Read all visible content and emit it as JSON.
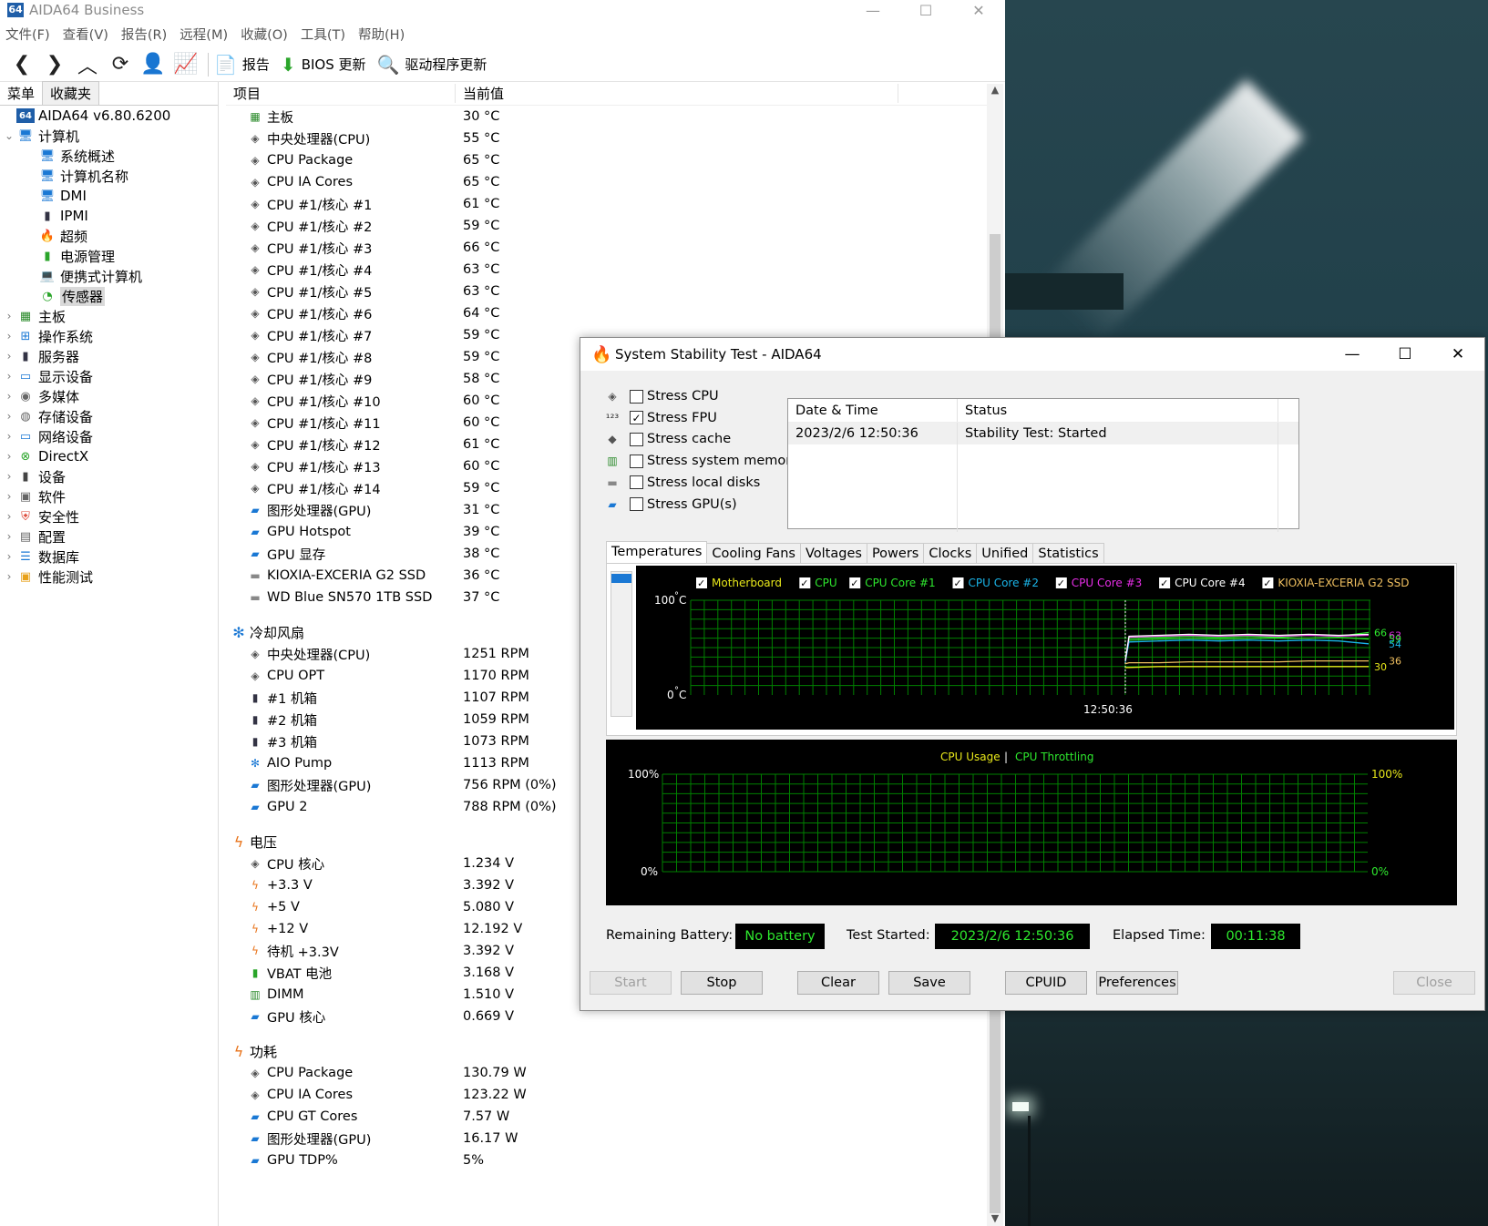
{
  "main_window": {
    "icon_text": "64",
    "title": "AIDA64 Business",
    "menu": [
      "文件(F)",
      "查看(V)",
      "报告(R)",
      "远程(M)",
      "收藏(O)",
      "工具(T)",
      "帮助(H)"
    ],
    "toolbar": {
      "report": "报告",
      "bios_update": "BIOS 更新",
      "driver_update": "驱动程序更新"
    },
    "left_tabs": [
      "菜单",
      "收藏夹"
    ],
    "tree": [
      {
        "label": "AIDA64 v6.80.6200",
        "icon": "aida-icon",
        "indent": 0,
        "arrow": ""
      },
      {
        "label": "计算机",
        "icon": "computer-icon",
        "indent": 0,
        "arrow": "down"
      },
      {
        "label": "系统概述",
        "icon": "computer-icon",
        "indent": 2,
        "arrow": ""
      },
      {
        "label": "计算机名称",
        "icon": "computer-icon",
        "indent": 2,
        "arrow": ""
      },
      {
        "label": "DMI",
        "icon": "computer-icon",
        "indent": 2,
        "arrow": ""
      },
      {
        "label": "IPMI",
        "icon": "server-icon",
        "indent": 2,
        "arrow": ""
      },
      {
        "label": "超频",
        "icon": "flame-icon",
        "indent": 2,
        "arrow": ""
      },
      {
        "label": "电源管理",
        "icon": "battery-icon",
        "indent": 2,
        "arrow": ""
      },
      {
        "label": "便携式计算机",
        "icon": "laptop-icon",
        "indent": 2,
        "arrow": ""
      },
      {
        "label": "传感器",
        "icon": "gauge-icon",
        "indent": 2,
        "arrow": "",
        "selected": true
      },
      {
        "label": "主板",
        "icon": "motherboard-icon",
        "indent": 0,
        "arrow": "right"
      },
      {
        "label": "操作系统",
        "icon": "windows-icon",
        "indent": 0,
        "arrow": "right"
      },
      {
        "label": "服务器",
        "icon": "server-icon",
        "indent": 0,
        "arrow": "right"
      },
      {
        "label": "显示设备",
        "icon": "monitor-icon",
        "indent": 0,
        "arrow": "right"
      },
      {
        "label": "多媒体",
        "icon": "speaker-icon",
        "indent": 0,
        "arrow": "right"
      },
      {
        "label": "存储设备",
        "icon": "storage-icon",
        "indent": 0,
        "arrow": "right"
      },
      {
        "label": "网络设备",
        "icon": "network-icon",
        "indent": 0,
        "arrow": "right"
      },
      {
        "label": "DirectX",
        "icon": "xbox-icon",
        "indent": 0,
        "arrow": "right"
      },
      {
        "label": "设备",
        "icon": "device-icon",
        "indent": 0,
        "arrow": "right"
      },
      {
        "label": "软件",
        "icon": "software-icon",
        "indent": 0,
        "arrow": "right"
      },
      {
        "label": "安全性",
        "icon": "shield-icon",
        "indent": 0,
        "arrow": "right"
      },
      {
        "label": "配置",
        "icon": "config-icon",
        "indent": 0,
        "arrow": "right"
      },
      {
        "label": "数据库",
        "icon": "database-icon",
        "indent": 0,
        "arrow": "right"
      },
      {
        "label": "性能测试",
        "icon": "benchmark-icon",
        "indent": 0,
        "arrow": "right"
      }
    ],
    "list_headers": {
      "item": "项目",
      "value": "当前值"
    },
    "groups": [
      {
        "title": "",
        "icon": "",
        "rows": [
          {
            "name": "主板",
            "value": "30 °C",
            "icon": "motherboard-icon"
          },
          {
            "name": "中央处理器(CPU)",
            "value": "55 °C",
            "icon": "cpu-icon"
          },
          {
            "name": "CPU Package",
            "value": "65 °C",
            "icon": "cpu-icon"
          },
          {
            "name": "CPU IA Cores",
            "value": "65 °C",
            "icon": "cpu-icon"
          },
          {
            "name": "CPU #1/核心 #1",
            "value": "61 °C",
            "icon": "cpu-icon"
          },
          {
            "name": "CPU #1/核心 #2",
            "value": "59 °C",
            "icon": "cpu-icon"
          },
          {
            "name": "CPU #1/核心 #3",
            "value": "66 °C",
            "icon": "cpu-icon"
          },
          {
            "name": "CPU #1/核心 #4",
            "value": "63 °C",
            "icon": "cpu-icon"
          },
          {
            "name": "CPU #1/核心 #5",
            "value": "63 °C",
            "icon": "cpu-icon"
          },
          {
            "name": "CPU #1/核心 #6",
            "value": "64 °C",
            "icon": "cpu-icon"
          },
          {
            "name": "CPU #1/核心 #7",
            "value": "59 °C",
            "icon": "cpu-icon"
          },
          {
            "name": "CPU #1/核心 #8",
            "value": "59 °C",
            "icon": "cpu-icon"
          },
          {
            "name": "CPU #1/核心 #9",
            "value": "58 °C",
            "icon": "cpu-icon"
          },
          {
            "name": "CPU #1/核心 #10",
            "value": "60 °C",
            "icon": "cpu-icon"
          },
          {
            "name": "CPU #1/核心 #11",
            "value": "60 °C",
            "icon": "cpu-icon"
          },
          {
            "name": "CPU #1/核心 #12",
            "value": "61 °C",
            "icon": "cpu-icon"
          },
          {
            "name": "CPU #1/核心 #13",
            "value": "60 °C",
            "icon": "cpu-icon"
          },
          {
            "name": "CPU #1/核心 #14",
            "value": "59 °C",
            "icon": "cpu-icon"
          },
          {
            "name": "图形处理器(GPU)",
            "value": "31 °C",
            "icon": "gpu-icon"
          },
          {
            "name": "GPU Hotspot",
            "value": "39 °C",
            "icon": "gpu-icon"
          },
          {
            "name": "GPU 显存",
            "value": "38 °C",
            "icon": "gpu-icon"
          },
          {
            "name": "KIOXIA-EXCERIA G2 SSD",
            "value": "36 °C",
            "icon": "disk-icon"
          },
          {
            "name": "WD Blue SN570 1TB SSD",
            "value": "37 °C",
            "icon": "disk-icon"
          }
        ]
      },
      {
        "title": "冷却风扇",
        "icon": "fan-icon",
        "rows": [
          {
            "name": "中央处理器(CPU)",
            "value": "1251 RPM",
            "icon": "cpu-icon"
          },
          {
            "name": "CPU OPT",
            "value": "1170 RPM",
            "icon": "cpu-icon"
          },
          {
            "name": "#1 机箱",
            "value": "1107 RPM",
            "icon": "case-icon"
          },
          {
            "name": "#2 机箱",
            "value": "1059 RPM",
            "icon": "case-icon"
          },
          {
            "name": "#3 机箱",
            "value": "1073 RPM",
            "icon": "case-icon"
          },
          {
            "name": "AIO Pump",
            "value": "1113 RPM",
            "icon": "fan-icon"
          },
          {
            "name": "图形处理器(GPU)",
            "value": "756 RPM  (0%)",
            "icon": "gpu-icon"
          },
          {
            "name": "GPU 2",
            "value": "788 RPM  (0%)",
            "icon": "gpu-icon"
          }
        ]
      },
      {
        "title": "电压",
        "icon": "voltage-icon",
        "rows": [
          {
            "name": "CPU 核心",
            "value": "1.234 V",
            "icon": "cpu-icon"
          },
          {
            "name": "+3.3 V",
            "value": "3.392 V",
            "icon": "voltage-icon"
          },
          {
            "name": "+5 V",
            "value": "5.080 V",
            "icon": "voltage-icon"
          },
          {
            "name": "+12 V",
            "value": "12.192 V",
            "icon": "voltage-icon"
          },
          {
            "name": "待机 +3.3V",
            "value": "3.392 V",
            "icon": "voltage-icon"
          },
          {
            "name": "VBAT 电池",
            "value": "3.168 V",
            "icon": "battery-icon"
          },
          {
            "name": "DIMM",
            "value": "1.510 V",
            "icon": "memory-icon"
          },
          {
            "name": "GPU 核心",
            "value": "0.669 V",
            "icon": "gpu-icon"
          }
        ]
      },
      {
        "title": "功耗",
        "icon": "voltage-icon",
        "rows": [
          {
            "name": "CPU Package",
            "value": "130.79 W",
            "icon": "cpu-icon"
          },
          {
            "name": "CPU IA Cores",
            "value": "123.22 W",
            "icon": "cpu-icon"
          },
          {
            "name": "CPU GT Cores",
            "value": "7.57 W",
            "icon": "gpu-icon"
          },
          {
            "name": "图形处理器(GPU)",
            "value": "16.17 W",
            "icon": "gpu-icon"
          },
          {
            "name": "GPU TDP%",
            "value": "5%",
            "icon": "gpu-icon"
          }
        ]
      }
    ]
  },
  "stability_window": {
    "title": "System Stability Test - AIDA64",
    "stress_options": [
      {
        "label": "Stress CPU",
        "checked": false,
        "icon": "cpu-icon"
      },
      {
        "label": "Stress FPU",
        "checked": true,
        "icon": "fpu-icon"
      },
      {
        "label": "Stress cache",
        "checked": false,
        "icon": "cache-icon"
      },
      {
        "label": "Stress system memory",
        "checked": false,
        "icon": "memory-icon"
      },
      {
        "label": "Stress local disks",
        "checked": false,
        "icon": "disk-icon"
      },
      {
        "label": "Stress GPU(s)",
        "checked": false,
        "icon": "gpu-icon"
      }
    ],
    "status_table": {
      "headers": [
        "Date & Time",
        "Status"
      ],
      "rows": [
        [
          "2023/2/6 12:50:36",
          "Stability Test: Started"
        ]
      ]
    },
    "graph_tabs": [
      "Temperatures",
      "Cooling Fans",
      "Voltages",
      "Powers",
      "Clocks",
      "Unified",
      "Statistics"
    ],
    "active_tab": "Temperatures",
    "temp_legend": [
      {
        "label": "Motherboard",
        "color": "#e8e81a"
      },
      {
        "label": "CPU",
        "color": "#2ee82e"
      },
      {
        "label": "CPU Core #1",
        "color": "#2ee82e"
      },
      {
        "label": "CPU Core #2",
        "color": "#1ab4e8"
      },
      {
        "label": "CPU Core #3",
        "color": "#e82ee8"
      },
      {
        "label": "CPU Core #4",
        "color": "#ffffff"
      },
      {
        "label": "KIOXIA-EXCERIA G2 SSD",
        "color": "#f0c060"
      }
    ],
    "usage_legend": {
      "usage": "CPU Usage",
      "separator": "|",
      "throttling": "CPU Throttling",
      "usage_color": "#e8e81a",
      "throttling_color": "#2ee82e"
    },
    "info": {
      "battery_label": "Remaining Battery:",
      "battery_value": "No battery",
      "started_label": "Test Started:",
      "started_value": "2023/2/6 12:50:36",
      "elapsed_label": "Elapsed Time:",
      "elapsed_value": "00:11:38"
    },
    "buttons": {
      "start": "Start",
      "stop": "Stop",
      "clear": "Clear",
      "save": "Save",
      "cpuid": "CPUID",
      "preferences": "Preferences",
      "close": "Close"
    }
  },
  "chart_data": [
    {
      "type": "line",
      "title": "Temperatures",
      "y_top_label": "100",
      "y_bottom_label": "0",
      "y_unit": "°C",
      "ylim": [
        0,
        100
      ],
      "x_label": "12:50:36",
      "right_labels": [
        {
          "text": "66",
          "value": 66,
          "color": "#2ee82e"
        },
        {
          "text": "63",
          "value": 63,
          "color": "#e82ee8"
        },
        {
          "text": "59",
          "value": 59,
          "color": "#2ee82e"
        },
        {
          "text": "54",
          "value": 54,
          "color": "#1ab4e8"
        },
        {
          "text": "30",
          "value": 30,
          "color": "#e8e81a"
        },
        {
          "text": "36",
          "value": 36,
          "color": "#f0c060"
        }
      ],
      "series": [
        {
          "name": "Motherboard",
          "values": [
            29,
            29,
            30,
            30,
            30,
            30,
            30,
            30,
            30,
            30
          ]
        },
        {
          "name": "CPU",
          "values": [
            37,
            58,
            59,
            60,
            59,
            60,
            60,
            60,
            61,
            59
          ]
        },
        {
          "name": "CPU Core #1",
          "values": [
            36,
            60,
            61,
            62,
            61,
            62,
            61,
            63,
            62,
            66
          ]
        },
        {
          "name": "CPU Core #2",
          "values": [
            35,
            56,
            57,
            58,
            57,
            58,
            57,
            58,
            57,
            54
          ]
        },
        {
          "name": "CPU Core #3",
          "values": [
            36,
            61,
            62,
            63,
            62,
            63,
            62,
            63,
            62,
            63
          ]
        },
        {
          "name": "CPU Core #4",
          "values": [
            36,
            62,
            63,
            64,
            63,
            64,
            63,
            64,
            63,
            64
          ]
        },
        {
          "name": "KIOXIA-EXCERIA G2 SSD",
          "values": [
            33,
            34,
            34,
            35,
            35,
            35,
            35,
            36,
            36,
            36
          ]
        }
      ],
      "grid": true
    },
    {
      "type": "line",
      "title": "CPU Usage | CPU Throttling",
      "left_top_label": "100%",
      "left_bottom_label": "0%",
      "right_top_label": "100%",
      "right_bottom_label": "0%",
      "ylim": [
        0,
        100
      ],
      "series": [],
      "grid": true
    }
  ]
}
